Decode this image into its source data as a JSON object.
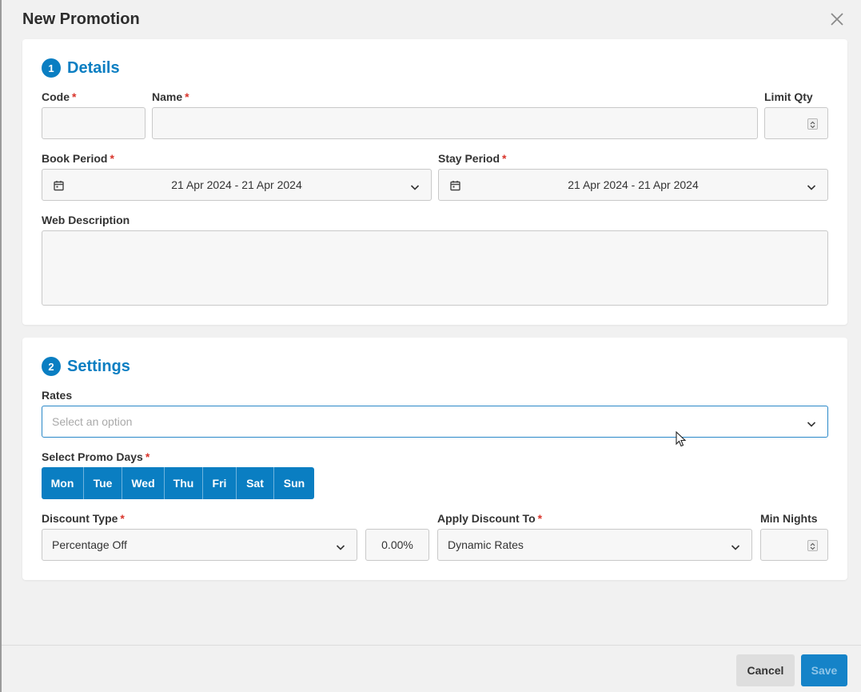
{
  "modal": {
    "title": "New Promotion"
  },
  "details": {
    "step": "1",
    "title": "Details",
    "code_label": "Code",
    "name_label": "Name",
    "limit_qty_label": "Limit Qty",
    "book_period_label": "Book Period",
    "book_period_value": "21 Apr 2024 - 21 Apr 2024",
    "stay_period_label": "Stay Period",
    "stay_period_value": "21 Apr 2024 - 21 Apr 2024",
    "web_description_label": "Web Description",
    "required_mark": "*"
  },
  "settings": {
    "step": "2",
    "title": "Settings",
    "rates_label": "Rates",
    "rates_placeholder": "Select an option",
    "promo_days_label": "Select Promo Days",
    "days": [
      "Mon",
      "Tue",
      "Wed",
      "Thu",
      "Fri",
      "Sat",
      "Sun"
    ],
    "discount_type_label": "Discount Type",
    "discount_type_value": "Percentage Off",
    "discount_amount": "0.00%",
    "apply_discount_label": "Apply Discount To",
    "apply_discount_value": "Dynamic Rates",
    "min_nights_label": "Min Nights",
    "required_mark": "*"
  },
  "footer": {
    "cancel_label": "Cancel",
    "save_label": "Save"
  },
  "colors": {
    "accent": "#0a7ec2",
    "required": "#d9342b"
  }
}
